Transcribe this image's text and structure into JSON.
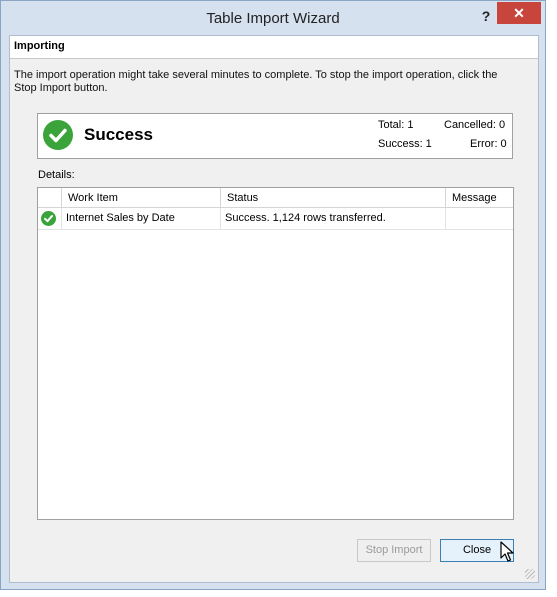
{
  "window": {
    "title": "Table Import Wizard",
    "help_label": "?",
    "close_label": "✕"
  },
  "header": {
    "title": "Importing"
  },
  "description": "The import operation might take several minutes to complete. To stop the import operation, click the Stop Import button.",
  "summary": {
    "status_label": "Success",
    "status_icon": "check-circle-icon",
    "total": "Total: 1",
    "cancelled": "Cancelled: 0",
    "success": "Success: 1",
    "error": "Error: 0"
  },
  "details_label": "Details:",
  "grid": {
    "columns": [
      "Work Item",
      "Status",
      "Message"
    ],
    "rows": [
      {
        "icon": "check-circle-icon",
        "work_item": "Internet Sales by Date",
        "status": "Success. 1,124 rows transferred.",
        "message": ""
      }
    ]
  },
  "buttons": {
    "stop_import": "Stop Import",
    "close": "Close"
  },
  "colors": {
    "success_green": "#3aa43a",
    "window_frame": "#d6e1ef",
    "close_red": "#c7453b"
  }
}
